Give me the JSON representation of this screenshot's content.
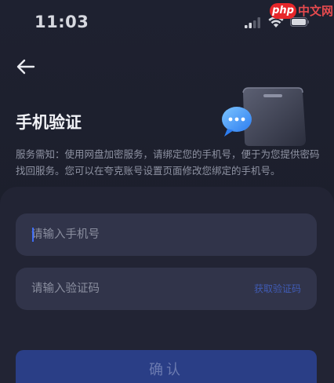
{
  "status_bar": {
    "time": "11:03"
  },
  "watermark": {
    "brand": "php",
    "site": "中文网"
  },
  "header": {
    "back_icon": "back-arrow-icon"
  },
  "page": {
    "title": "手机验证",
    "notice": "服务需知：使用网盘加密服务，请绑定您的手机号，便于为您提供密码找回服务。您可以在夸克账号设置页面修改您绑定的手机号。"
  },
  "form": {
    "phone_placeholder": "请输入手机号",
    "phone_value": "",
    "code_placeholder": "请输入验证码",
    "code_value": "",
    "get_code_label": "获取验证码",
    "confirm_label": "确认"
  },
  "colors": {
    "background": "#1d1f2a",
    "field": "#31344a",
    "accent": "#3f6df5",
    "button": "#2a3e86"
  }
}
